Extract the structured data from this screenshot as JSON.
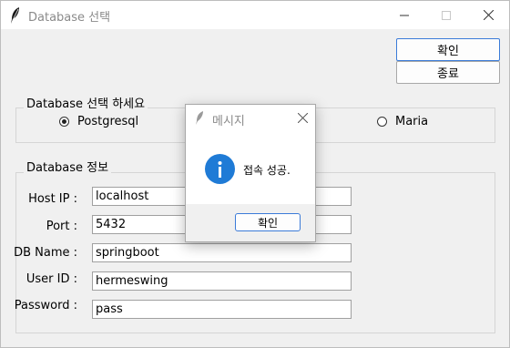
{
  "window": {
    "title": "Database 선택",
    "icon": "feather-icon",
    "controls": [
      "minimize-icon",
      "maximize-icon",
      "close-icon"
    ]
  },
  "buttons": {
    "confirm_label": "확인",
    "exit_label": "종료"
  },
  "db_select": {
    "legend": "Database 선택 하세요",
    "options": [
      {
        "label": "Postgresql",
        "selected": true
      },
      {
        "label": "Maria",
        "selected": false
      }
    ]
  },
  "db_info": {
    "legend": "Database 정보",
    "fields": [
      {
        "label": "Host IP :",
        "value": "localhost"
      },
      {
        "label": "Port :",
        "value": "5432"
      },
      {
        "label": "DB Name :",
        "value": "springboot"
      },
      {
        "label": "User ID :",
        "value": "hermeswing"
      },
      {
        "label": "Password :",
        "value": "pass"
      }
    ]
  },
  "dialog": {
    "title": "메시지",
    "icon": "info-icon",
    "message": "접속 성공.",
    "button_label": "확인"
  },
  "colors": {
    "accent": "#3b7bd8",
    "info_icon": "#1f7bd6",
    "window_bg": "#f0f0f0"
  }
}
